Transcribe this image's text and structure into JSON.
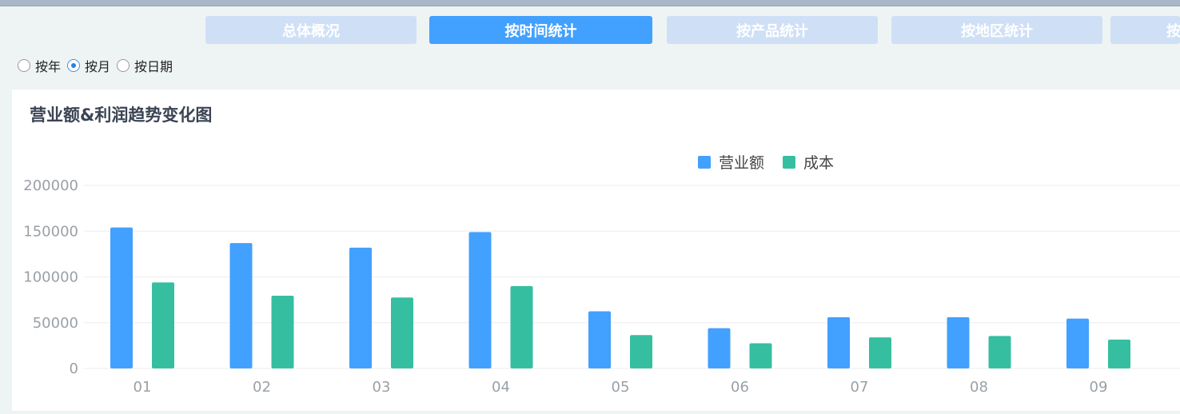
{
  "tabs": [
    {
      "label": "总体概况",
      "active": false
    },
    {
      "label": "按时间统计",
      "active": true
    },
    {
      "label": "按产品统计",
      "active": false
    },
    {
      "label": "按地区统计",
      "active": false
    },
    {
      "label": "按",
      "active": false
    }
  ],
  "granularity": {
    "options": [
      {
        "label": "按年",
        "checked": false
      },
      {
        "label": "按月",
        "checked": true
      },
      {
        "label": "按日期",
        "checked": false
      }
    ]
  },
  "colors": {
    "revenue": "#42a0ff",
    "cost": "#35bfa0",
    "axis_text": "#9aa0a6",
    "grid": "#eeeeee",
    "active_tab": "#42a0ff",
    "inactive_tab": "#cfe0f6"
  },
  "chart_data": {
    "type": "bar",
    "title": "营业额&利润趋势变化图",
    "categories": [
      "01",
      "02",
      "03",
      "04",
      "05",
      "06",
      "07",
      "08",
      "09"
    ],
    "series": [
      {
        "name": "营业额",
        "values": [
          154000,
          137000,
          132000,
          149000,
          62500,
          44000,
          56000,
          56000,
          54500
        ]
      },
      {
        "name": "成本",
        "values": [
          94000,
          79500,
          77500,
          90000,
          36500,
          27500,
          34000,
          35500,
          31500
        ]
      }
    ],
    "yticks": [
      "200000",
      "150000",
      "100000",
      "50000",
      "0"
    ],
    "ylim": [
      0,
      200000
    ],
    "grid": true,
    "legend": "top-center"
  }
}
